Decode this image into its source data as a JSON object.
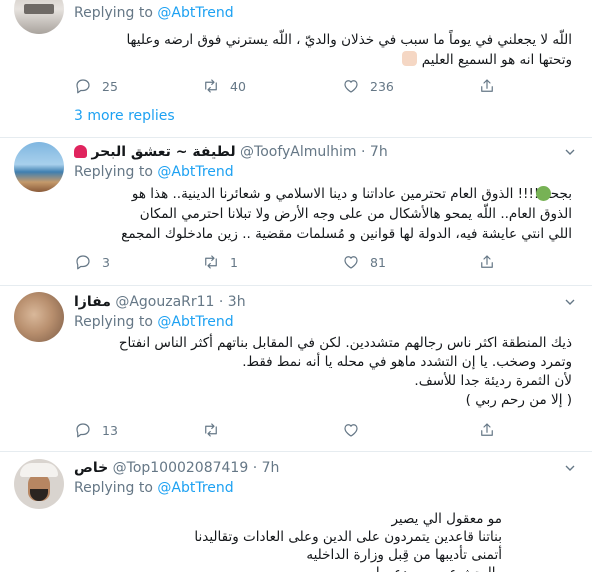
{
  "tweet1": {
    "reply_prefix": "Replying to",
    "reply_handle": "@AbtTrend",
    "text_line1": "اللّه لا يجعلني في يوماً ما سبب في خذلان والديّ ، اللّه يسترني فوق ارضه وعليها",
    "text_line2": "وتحتها انه هو السميع العليم",
    "replies": "25",
    "retweets": "40",
    "likes": "236",
    "more_replies": "3 more replies"
  },
  "tweet2": {
    "name": "لطيفة ~ تعشق البحر",
    "handle": "@ToofyAlmulhim",
    "time": "· 7h",
    "reply_prefix": "Replying to",
    "reply_handle": "@AbtTrend",
    "text_line1": "بجحة !!!! الذوق العام تحترمين عاداتنا و دينا الاسلامي و شعائرنا الدينية.. هذا هو",
    "text_line2": "الذوق العام..  اللّه يمحو هالأشكال من على وجه الأرض ولا تبلانا احترمي المكان",
    "text_line3": "اللي انتي عايشة فيه، الدولة لها قوانين و مُسلمات مقضية .. زين مادخلوك المجمع",
    "replies": "3",
    "retweets": "1",
    "likes": "81"
  },
  "tweet3": {
    "name": "مفازا",
    "handle": "@AgouzaRr11",
    "time": "· 3h",
    "reply_prefix": "Replying to",
    "reply_handle": "@AbtTrend",
    "text_line1": "ذيك المنطقة اكثر ناس رجالهم متشددين. لكن في المقابل بناتهم أكثر الناس انفتاح",
    "text_line2": "وتمرد وصخب. يا إن التشدد ماهو في محله يا أنه نمط فقط.",
    "text_line3": "لأن الثمرة رديئة جدا للأسف.",
    "text_line4": "( إلا من رحم ربي )",
    "replies": "13",
    "retweets": "",
    "likes": ""
  },
  "tweet4": {
    "name": "خاص",
    "handle": "@Top10002087419",
    "time": "· 7h",
    "reply_prefix": "Replying to",
    "reply_handle": "@AbtTrend",
    "text_line1": "مو معقول الي يصير",
    "text_line2": "بناتنا قاعدين يتمردون على الدين وعلى العادات وتقاليدنا",
    "text_line3": "أتمنى تأديبها من قِبل وزارة الداخليه",
    "text_line4": "والبحث عن من يدعمها"
  },
  "icons": [
    "reply-icon",
    "retweet-icon",
    "like-icon",
    "share-icon",
    "caret-down-icon",
    "heart-emoji",
    "sick-face-emoji",
    "praying-hands-emoji"
  ],
  "colors": {
    "link": "#1da1f2",
    "secondary_text": "#657786",
    "divider": "#e6ecf0",
    "heart": "#e0245e"
  }
}
